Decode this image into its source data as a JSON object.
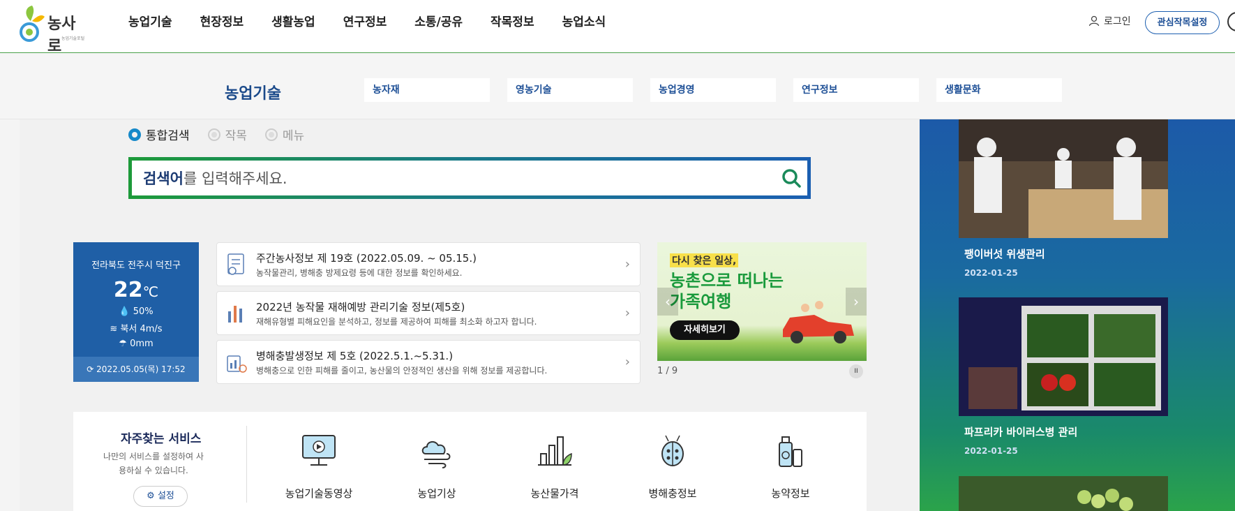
{
  "header": {
    "logo_text": "농사로",
    "logo_sub": "농업기술포털",
    "nav": [
      "농업기술",
      "현장정보",
      "생활농업",
      "연구정보",
      "소통/공유",
      "작목정보",
      "농업소식"
    ],
    "login_label": "로그인",
    "fav_button": "관심작목설정"
  },
  "subnav": {
    "title": "농업기술",
    "items": [
      "농자재",
      "영농기술",
      "농업경영",
      "연구정보",
      "생활문화"
    ]
  },
  "search": {
    "options": [
      "통합검색",
      "작목",
      "메뉴"
    ],
    "selected": "통합검색",
    "placeholder_bold": "검색어",
    "placeholder_rest": "를 입력해주세요."
  },
  "weather": {
    "location": "전라북도 전주시 덕진구",
    "temp": "22",
    "unit": "℃",
    "humidity": "50%",
    "wind": "북서 4m/s",
    "rain": "0mm",
    "updated": "2022.05.05(목) 17:52"
  },
  "news": [
    {
      "title": "주간농사정보 제 19호 (2022.05.09. ~ 05.15.)",
      "desc": "농작물관리, 병해충 방제요령 등에 대한 정보를 확인하세요."
    },
    {
      "title": "2022년 농작물 재해예방 관리기술 정보(제5호)",
      "desc": "재해유형별 피해요인을 분석하고, 정보를 제공하여 피해를 최소화 하고자 합니다."
    },
    {
      "title": "병해충발생정보 제 5호 (2022.5.1.~5.31.)",
      "desc": "병해충으로 인한 피해를 줄이고, 농산물의 안정적인 생산을 위해 정보를 제공합니다."
    }
  ],
  "banner": {
    "line1": "다시 찾은 일상,",
    "line2": "농촌으로 떠나는",
    "line3": "가족여행",
    "button": "자세히보기",
    "page": "1 / 9",
    "pause": "II"
  },
  "services": {
    "title": "자주찾는 서비스",
    "desc": "나만의 서비스를 설정하여 사용하실 수 있습니다.",
    "setting": "설정",
    "items": [
      "농업기술동영상",
      "농업기상",
      "농산물가격",
      "병해충정보",
      "농약정보"
    ]
  },
  "side_cards": [
    {
      "title": "팽이버섯 위생관리",
      "date": "2022-01-25"
    },
    {
      "title": "파프리카 바이러스병 관리",
      "date": "2022-01-25"
    }
  ]
}
